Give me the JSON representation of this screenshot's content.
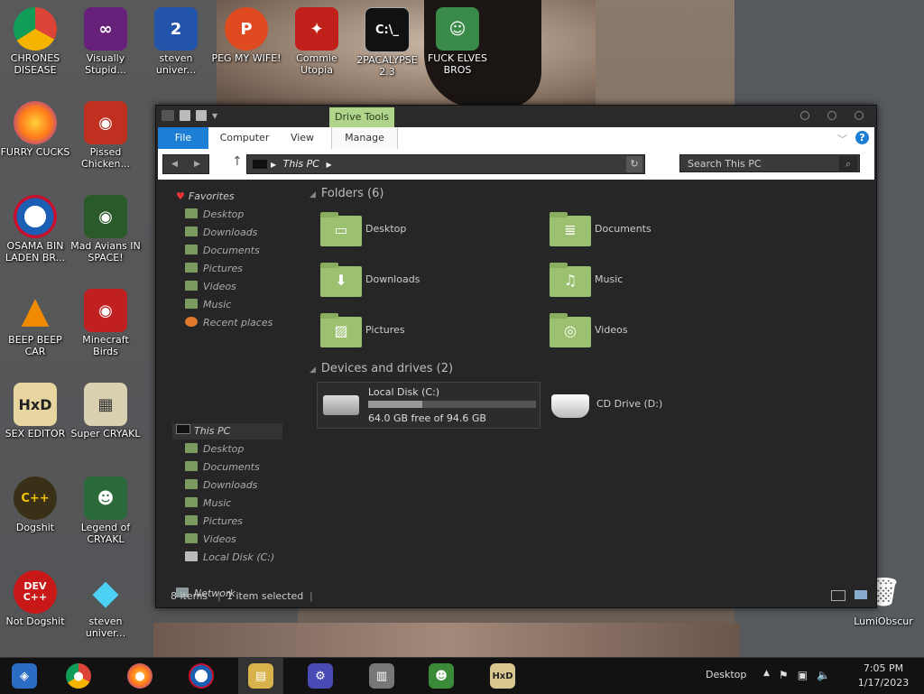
{
  "desktop": {
    "icons": [
      {
        "label": "CHRONES DISEASE",
        "glyph": "",
        "color": "#4285f4"
      },
      {
        "label": "Visually Stupid...",
        "glyph": "∞",
        "color": "#68217a"
      },
      {
        "label": "steven univer...",
        "glyph": "2",
        "color": "#2255aa"
      },
      {
        "label": "PEG MY WIFE!",
        "glyph": "P",
        "color": "#e04a20"
      },
      {
        "label": "Commie Utopia",
        "glyph": "✦",
        "color": "#c0201a"
      },
      {
        "label": "2PACALYPSE 2.3",
        "glyph": "C:\\_",
        "color": "#111111"
      },
      {
        "label": "FUCK ELVES BROS",
        "glyph": "☺",
        "color": "#3a8a4a"
      },
      {
        "label": "FURRY CUCKS",
        "glyph": "",
        "color": "#e66000"
      },
      {
        "label": "Pissed Chicken...",
        "glyph": "◉",
        "color": "#c03020"
      },
      {
        "label": "OSAMA BIN LADEN BR...",
        "glyph": "◐",
        "color": "#1a5fb4"
      },
      {
        "label": "Mad Avians IN SPACE!",
        "glyph": "◉",
        "color": "#2a5a2a"
      },
      {
        "label": "BEEP BEEP CAR",
        "glyph": "▲",
        "color": "#f08a00"
      },
      {
        "label": "Minecraft Birds",
        "glyph": "◉",
        "color": "#c02020"
      },
      {
        "label": "SEX EDITOR",
        "glyph": "HxD",
        "color": "#e8d6a0"
      },
      {
        "label": "Super CRYAKL",
        "glyph": "▦",
        "color": "#d8d0b0"
      },
      {
        "label": "Dogshit",
        "glyph": "C++",
        "color": "#3a3018"
      },
      {
        "label": "Legend of CRYAKL",
        "glyph": "☻",
        "color": "#2a6a3a"
      },
      {
        "label": "Not Dogshit",
        "glyph": "DEV C++",
        "color": "#c81818"
      },
      {
        "label": "steven univer...",
        "glyph": "◆",
        "color": "#22aadd"
      },
      {
        "label": "LumiObscur",
        "glyph": "🗑",
        "color": "#888888"
      }
    ]
  },
  "explorer": {
    "contextual_tab": "Drive Tools",
    "ribbon_tabs": {
      "file": "File",
      "computer": "Computer",
      "view": "View",
      "manage": "Manage"
    },
    "address": "This PC",
    "search_placeholder": "Search This PC",
    "nav": {
      "favorites": "Favorites",
      "fav_items": [
        "Desktop",
        "Downloads",
        "Documents",
        "Pictures",
        "Videos",
        "Music",
        "Recent places"
      ],
      "thispc": "This PC",
      "pc_items": [
        "Desktop",
        "Documents",
        "Downloads",
        "Music",
        "Pictures",
        "Videos",
        "Local Disk (C:)"
      ],
      "network": "Network"
    },
    "folders_header": "Folders (6)",
    "folders": [
      {
        "name": "Desktop",
        "glyph": "▭"
      },
      {
        "name": "Documents",
        "glyph": "≣"
      },
      {
        "name": "Downloads",
        "glyph": "⬇"
      },
      {
        "name": "Music",
        "glyph": "♫"
      },
      {
        "name": "Pictures",
        "glyph": "▨"
      },
      {
        "name": "Videos",
        "glyph": "◎"
      }
    ],
    "devices_header": "Devices and drives (2)",
    "local_disk": {
      "name": "Local Disk (C:)",
      "free": "64.0 GB free of 94.6 GB",
      "used_fraction": 0.32
    },
    "cd_drive": {
      "name": "CD Drive (D:)"
    },
    "status": {
      "items": "8 items",
      "selected": "1 item selected"
    }
  },
  "taskbar": {
    "apps": [
      {
        "name": "start",
        "glyph": "◈",
        "color": "#2b6cc4"
      },
      {
        "name": "chrome",
        "glyph": "●",
        "color": "#4285f4"
      },
      {
        "name": "firefox",
        "glyph": "●",
        "color": "#e66000"
      },
      {
        "name": "obama",
        "glyph": "◐",
        "color": "#1a5fb4"
      },
      {
        "name": "file-explorer",
        "glyph": "▤",
        "color": "#d8b24a"
      },
      {
        "name": "settings",
        "glyph": "⚙",
        "color": "#4a4ab4"
      },
      {
        "name": "store",
        "glyph": "▥",
        "color": "#777777"
      },
      {
        "name": "messenger",
        "glyph": "☻",
        "color": "#3a8a3a"
      },
      {
        "name": "hxd",
        "glyph": "HxD",
        "color": "#d8c890"
      }
    ],
    "desktop_label": "Desktop",
    "time": "7:05 PM",
    "date": "1/17/2023"
  }
}
